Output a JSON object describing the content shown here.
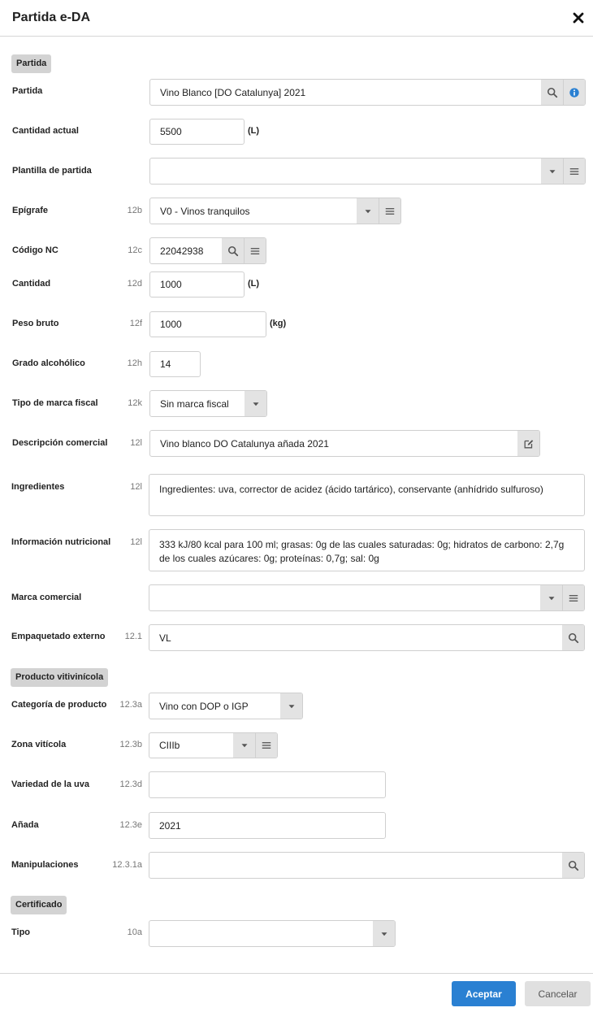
{
  "dialog": {
    "title": "Partida e-DA"
  },
  "sections": {
    "partida": "Partida",
    "producto": "Producto vitivinícola",
    "certificado": "Certificado"
  },
  "fields": {
    "partida": {
      "label": "Partida",
      "code": "",
      "value": "Vino Blanco [DO Catalunya] 2021"
    },
    "cantidad_actual": {
      "label": "Cantidad actual",
      "code": "",
      "value": "5500",
      "unit": "(L)"
    },
    "plantilla": {
      "label": "Plantilla de partida",
      "code": "",
      "value": ""
    },
    "epigrafe": {
      "label": "Epígrafe",
      "code": "12b",
      "value": "V0 - Vinos tranquilos"
    },
    "codigo_nc": {
      "label": "Código NC",
      "code": "12c",
      "value": "22042938"
    },
    "cantidad": {
      "label": "Cantidad",
      "code": "12d",
      "value": "1000",
      "unit": "(L)"
    },
    "peso_bruto": {
      "label": "Peso bruto",
      "code": "12f",
      "value": "1000",
      "unit": "(kg)"
    },
    "grado": {
      "label": "Grado alcohólico",
      "code": "12h",
      "value": "14"
    },
    "tipo_marca": {
      "label": "Tipo de marca fiscal",
      "code": "12k",
      "value": "Sin marca fiscal"
    },
    "descripcion": {
      "label": "Descripción comercial",
      "code": "12l",
      "value": "Vino blanco DO Catalunya añada 2021"
    },
    "ingredientes": {
      "label": "Ingredientes",
      "code": "12l",
      "value": "Ingredientes: uva, corrector de acidez (ácido tartárico), conservante (anhídrido sulfuroso)"
    },
    "nutricional": {
      "label": "Información nutricional",
      "code": "12l",
      "value": "333 kJ/80 kcal para 100 ml; grasas: 0g de las cuales saturadas: 0g; hidratos de carbono: 2,7g de los cuales azúcares: 0g; proteínas: 0,7g; sal: 0g"
    },
    "marca_comercial": {
      "label": "Marca comercial",
      "code": "",
      "value": ""
    },
    "empaquetado": {
      "label": "Empaquetado externo",
      "code": "12.1",
      "value": "VL"
    },
    "categoria": {
      "label": "Categoría de producto",
      "code": "12.3a",
      "value": "Vino con DOP o IGP"
    },
    "zona": {
      "label": "Zona vitícola",
      "code": "12.3b",
      "value": "CIIIb"
    },
    "variedad": {
      "label": "Variedad de la uva",
      "code": "12.3d",
      "value": ""
    },
    "anada": {
      "label": "Añada",
      "code": "12.3e",
      "value": "2021"
    },
    "manipulaciones": {
      "label": "Manipulaciones",
      "code": "12.3.1a",
      "value": ""
    },
    "tipo": {
      "label": "Tipo",
      "code": "10a",
      "value": ""
    }
  },
  "footer": {
    "accept_label": "Aceptar",
    "cancel_label": "Cancelar"
  },
  "colors": {
    "primary": "#2a80d2",
    "info_icon": "#2a80d2",
    "addon_bg": "#e3e3e3",
    "badge_bg": "#d3d3d3"
  }
}
